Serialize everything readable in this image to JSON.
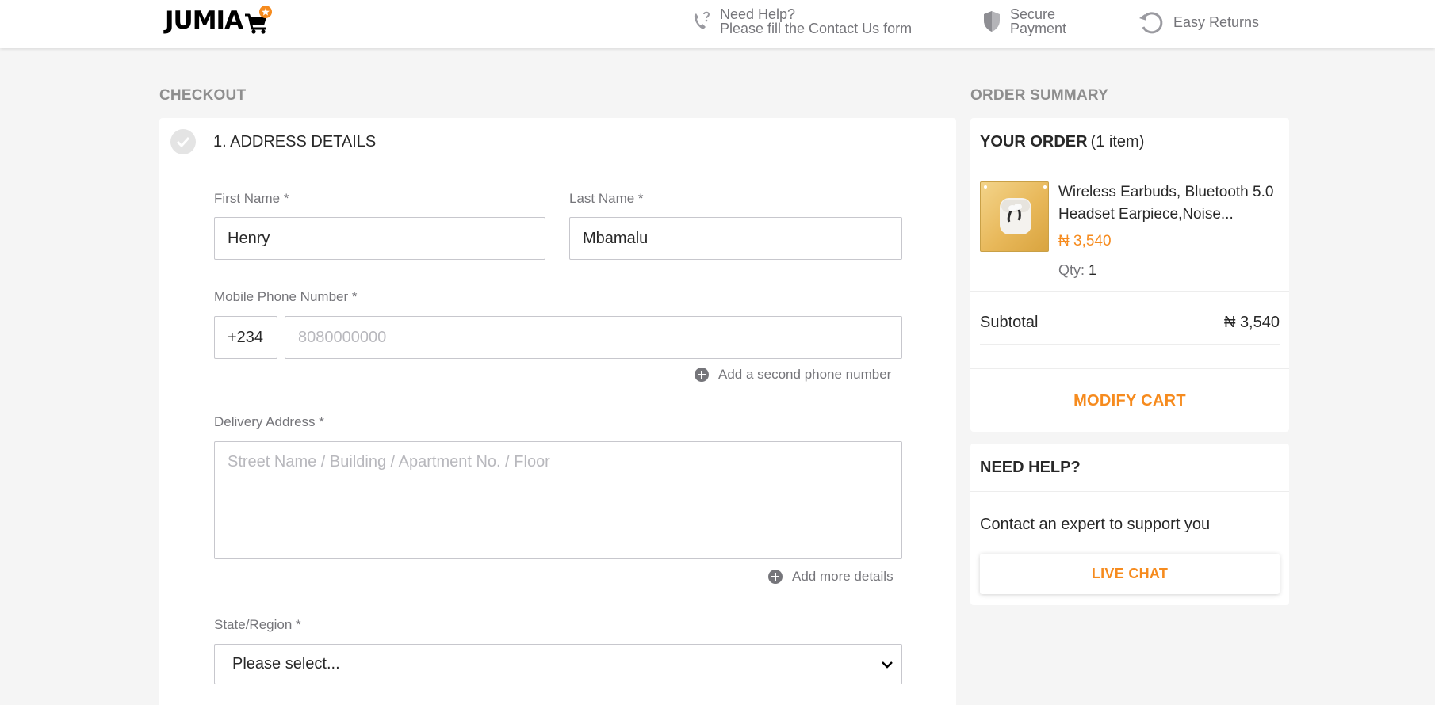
{
  "header": {
    "logo_text": "JUMIA",
    "help": {
      "line1": "Need Help?",
      "line2": "Please fill the Contact Us form"
    },
    "secure": {
      "line1": "Secure",
      "line2": "Payment"
    },
    "returns": "Easy Returns",
    "icons": [
      "phone-question-icon",
      "shield-icon",
      "returns-icon",
      "cart-icon"
    ]
  },
  "checkout": {
    "title": "CHECKOUT",
    "step_title": "1. ADDRESS DETAILS",
    "first_name": {
      "label": "First Name *",
      "value": "Henry"
    },
    "last_name": {
      "label": "Last Name *",
      "value": "Mbamalu"
    },
    "phone": {
      "label": "Mobile Phone Number *",
      "prefix": "+234",
      "placeholder": "8080000000"
    },
    "add_phone": "Add a second phone number",
    "address": {
      "label": "Delivery Address *",
      "placeholder": "Street Name / Building / Apartment No. / Floor"
    },
    "add_details": "Add more details",
    "state": {
      "label": "State/Region *",
      "value": "Please select..."
    }
  },
  "summary": {
    "title": "ORDER SUMMARY",
    "your_order": "YOUR ORDER",
    "item_count": "(1 item)",
    "product": {
      "name": "Wireless Earbuds, Bluetooth 5.0 Headset Earpiece,Noise...",
      "price": "₦ 3,540",
      "qty_label": "Qty:",
      "qty": "1"
    },
    "subtotal_label": "Subtotal",
    "subtotal_value": "₦ 3,540",
    "modify_cart": "MODIFY CART"
  },
  "help_card": {
    "title": "NEED HELP?",
    "text": "Contact an expert to support you",
    "button": "LIVE CHAT"
  },
  "colors": {
    "accent": "#f68b1e",
    "muted": "#75757a",
    "background": "#f5f5f5"
  }
}
